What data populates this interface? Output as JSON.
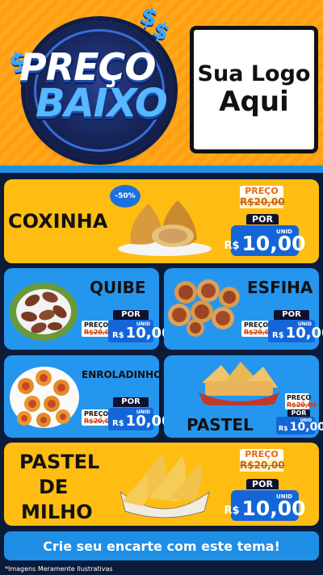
{
  "header": {
    "title_line1": "PREÇO",
    "title_line2": "BAIXO",
    "dollar_symbol": "$",
    "logo_line1": "Sua Logo",
    "logo_line2": "Aqui"
  },
  "labels": {
    "old_price_label": "PREÇO",
    "new_price_label": "POR",
    "currency": "R$",
    "unit": "UNID"
  },
  "products": {
    "coxinha": {
      "name": "COXINHA",
      "old_price": "R$20,00",
      "new_price": "10,00",
      "discount": "-50%"
    },
    "quibe": {
      "name": "QUIBE",
      "old_price": "R$20,00",
      "new_price": "10,00"
    },
    "esfiha": {
      "name": "ESFIHA",
      "old_price": "R$20,00",
      "new_price": "10,00"
    },
    "enroladinho": {
      "name": "ENROLADINHO",
      "old_price": "R$20,00",
      "new_price": "10,00"
    },
    "pastel": {
      "name": "PASTEL",
      "old_price": "R$20,00",
      "new_price": "10,00"
    },
    "pastel_milho": {
      "name_line1": "PASTEL",
      "name_line2": "DE",
      "name_line3": "MILHO",
      "old_price": "R$20,00",
      "new_price": "10,00"
    }
  },
  "footer": {
    "cta": "Crie seu encarte com este tema!",
    "disclaimer": "*Imagens Meramente Ilustrativas"
  },
  "colors": {
    "header_orange": "#ff9e0f",
    "card_yellow": "#ffbd12",
    "card_blue": "#2596ee",
    "price_blue": "#1466d8",
    "background_navy": "#0c1b3a"
  }
}
